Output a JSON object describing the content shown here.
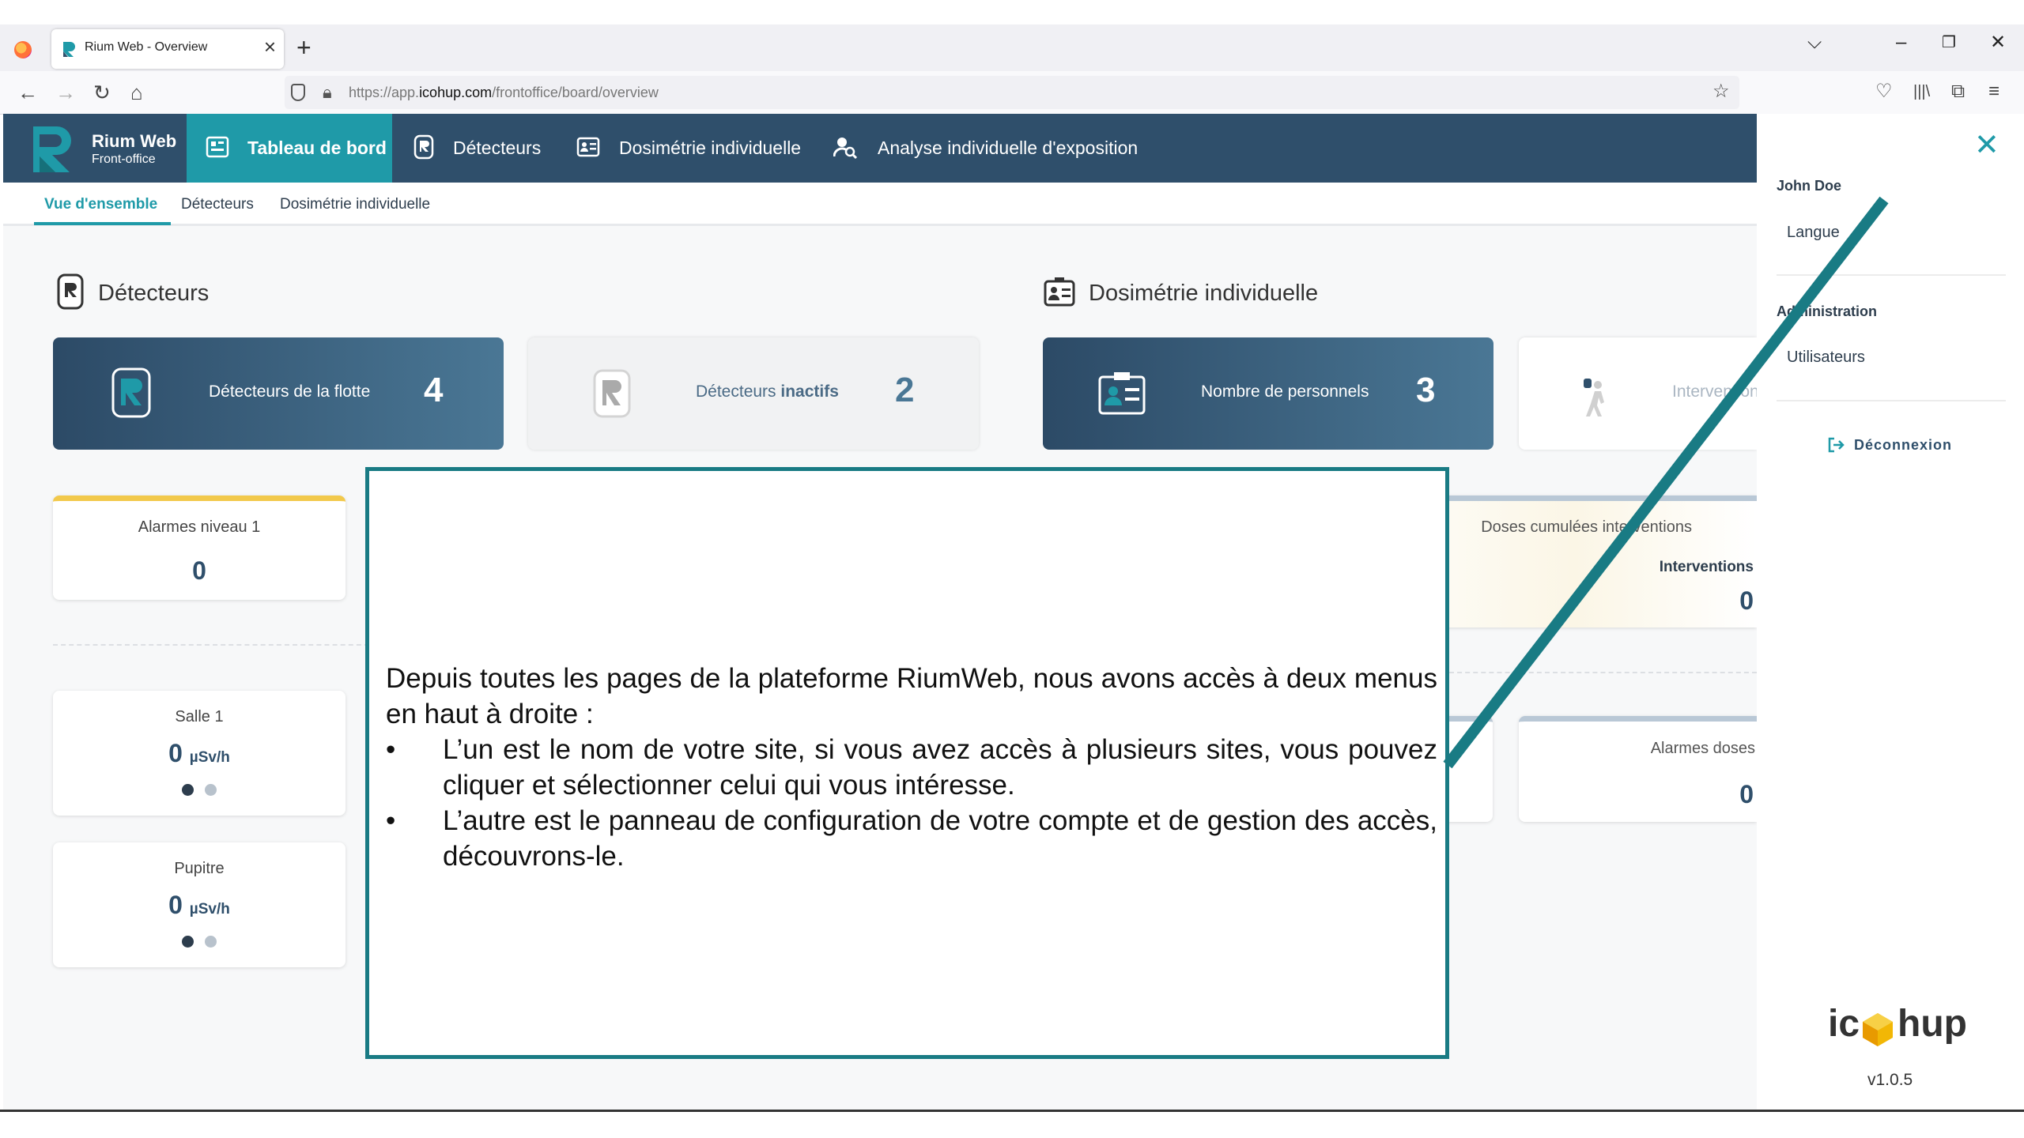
{
  "browser": {
    "tab_title": "Rium Web - Overview",
    "url_prefix": "https://app.",
    "url_host": "icohup.com",
    "url_path": "/frontoffice/board/overview"
  },
  "app": {
    "name": "Rium Web",
    "subtitle": "Front-office",
    "menu": [
      "Tableau de bord",
      "Détecteurs",
      "Dosimétrie individuelle",
      "Analyse individuelle d'exposition"
    ],
    "subnav": [
      "Vue d'ensemble",
      "Détecteurs",
      "Dosimétrie individuelle"
    ]
  },
  "sections": {
    "detecteurs_title": "Détecteurs",
    "dosimetrie_title": "Dosimétrie individuelle"
  },
  "stats": {
    "fleet_label": "Détecteurs de la flotte",
    "fleet_value": "4",
    "inactive_label_pre": "Détecteurs ",
    "inactive_label_bold": "inactifs",
    "inactive_value": "2",
    "personnel_label": "Nombre de personnels",
    "personnel_value": "3",
    "interventions_label": "Interventions"
  },
  "alarms_level1": {
    "title": "Alarmes niveau 1",
    "value": "0"
  },
  "rooms": [
    {
      "name": "Salle 1",
      "value": "0",
      "unit": "µSv/h"
    },
    {
      "name": "Pupitre",
      "value": "0",
      "unit": "µSv/h"
    }
  ],
  "doses": {
    "title": "Doses cumulées interventions",
    "col_label": "Interventions",
    "value": "0"
  },
  "alarm_doses": {
    "title": "Alarmes doses",
    "value": "0"
  },
  "note": {
    "intro": "Depuis toutes les pages de la plateforme RiumWeb, nous avons accès à deux menus en haut à droite :",
    "bullets": [
      "L’un est le nom de votre site, si vous avez accès à plusieurs sites, vous pouvez cliquer et sélectionner celui qui vous intéresse.",
      "L’autre est le panneau de configuration de votre compte et de gestion des accès, découvrons-le."
    ]
  },
  "side_panel": {
    "user": "John Doe",
    "language": "Langue",
    "admin_heading": "Administration",
    "users": "Utilisateurs",
    "logout": "Déconnexion",
    "brand": "icohup",
    "version": "v1.0.5"
  },
  "colors": {
    "header": "#2f4f6b",
    "accent": "#1f9aa8",
    "arrow": "#197b84",
    "alarm_yellow": "#f2c94c"
  }
}
